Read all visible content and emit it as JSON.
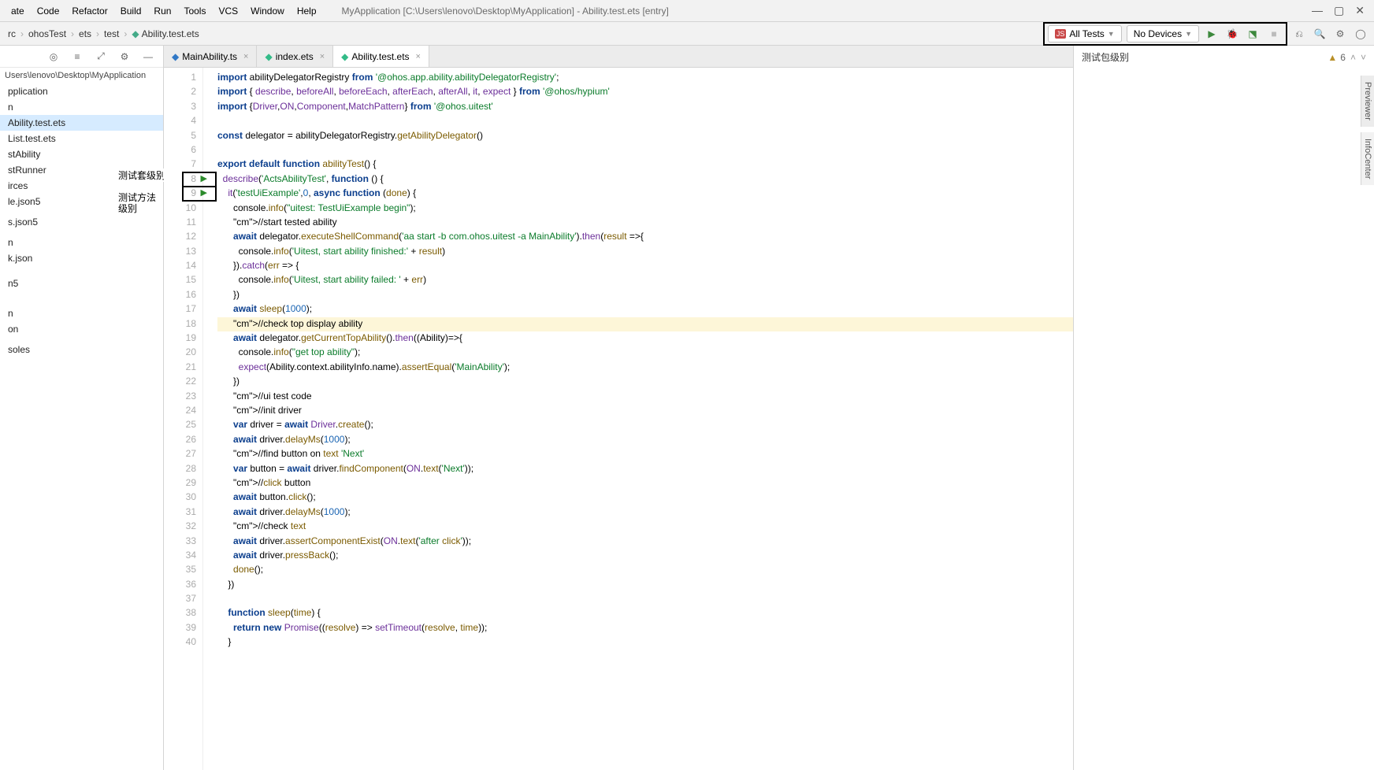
{
  "menubar": {
    "items": [
      "ate",
      "Code",
      "Refactor",
      "Build",
      "Run",
      "Tools",
      "VCS",
      "Window",
      "Help"
    ],
    "title": "MyApplication [C:\\Users\\lenovo\\Desktop\\MyApplication] - Ability.test.ets [entry]"
  },
  "breadcrumbs": [
    "rc",
    "ohosTest",
    "ets",
    "test",
    "Ability.test.ets"
  ],
  "run_config": {
    "label": "All Tests",
    "icon_color": "#c94747"
  },
  "device_dd": {
    "label": "No Devices"
  },
  "left": {
    "path": "Users\\lenovo\\Desktop\\MyApplication",
    "items": [
      "pplication",
      "n",
      "Ability.test.ets",
      "List.test.ets",
      "stAbility",
      "stRunner",
      "irces",
      "le.json5",
      "",
      "s.json5",
      "",
      "n",
      "k.json",
      "",
      "",
      "n5",
      "",
      "",
      "",
      "n",
      "on",
      "",
      "soles"
    ]
  },
  "left_labels": {
    "suite": "测试套级别",
    "method": "测试方法\n级别"
  },
  "tabs": [
    {
      "label": "MainAbility.ts",
      "active": false
    },
    {
      "label": "index.ets",
      "active": false
    },
    {
      "label": "Ability.test.ets",
      "active": true
    }
  ],
  "right": {
    "title": "测试包级别",
    "warn_count": "6"
  },
  "side_tabs": [
    "Previewer",
    "InfoCenter"
  ],
  "code": [
    {
      "n": 1,
      "t": "import abilityDelegatorRegistry from '@ohos.app.ability.abilityDelegatorRegistry';"
    },
    {
      "n": 2,
      "t": "import { describe, beforeAll, beforeEach, afterEach, afterAll, it, expect } from '@ohos/hypium'"
    },
    {
      "n": 3,
      "t": "import {Driver,ON,Component,MatchPattern} from '@ohos.uitest'"
    },
    {
      "n": 4,
      "t": ""
    },
    {
      "n": 5,
      "t": "const delegator = abilityDelegatorRegistry.getAbilityDelegator()"
    },
    {
      "n": 6,
      "t": ""
    },
    {
      "n": 7,
      "t": "export default function abilityTest() {"
    },
    {
      "n": 8,
      "t": "  describe('ActsAbilityTest', function () {",
      "run": true
    },
    {
      "n": 9,
      "t": "    it('testUiExample',0, async function (done) {",
      "run": true
    },
    {
      "n": 10,
      "t": "      console.info(\"uitest: TestUiExample begin\");"
    },
    {
      "n": 11,
      "t": "      //start tested ability"
    },
    {
      "n": 12,
      "t": "      await delegator.executeShellCommand('aa start -b com.ohos.uitest -a MainAbility').then(result =>{"
    },
    {
      "n": 13,
      "t": "        console.info('Uitest, start ability finished:' + result)"
    },
    {
      "n": 14,
      "t": "      }).catch(err => {"
    },
    {
      "n": 15,
      "t": "        console.info('Uitest, start ability failed: ' + err)"
    },
    {
      "n": 16,
      "t": "      })"
    },
    {
      "n": 17,
      "t": "      await sleep(1000);"
    },
    {
      "n": 18,
      "t": "      //check top display ability",
      "hl": true
    },
    {
      "n": 19,
      "t": "      await delegator.getCurrentTopAbility().then((Ability)=>{"
    },
    {
      "n": 20,
      "t": "        console.info(\"get top ability\");"
    },
    {
      "n": 21,
      "t": "        expect(Ability.context.abilityInfo.name).assertEqual('MainAbility');"
    },
    {
      "n": 22,
      "t": "      })"
    },
    {
      "n": 23,
      "t": "      //ui test code"
    },
    {
      "n": 24,
      "t": "      //init driver"
    },
    {
      "n": 25,
      "t": "      var driver = await Driver.create();"
    },
    {
      "n": 26,
      "t": "      await driver.delayMs(1000);"
    },
    {
      "n": 27,
      "t": "      //find button on text 'Next'"
    },
    {
      "n": 28,
      "t": "      var button = await driver.findComponent(ON.text('Next'));"
    },
    {
      "n": 29,
      "t": "      //click button"
    },
    {
      "n": 30,
      "t": "      await button.click();"
    },
    {
      "n": 31,
      "t": "      await driver.delayMs(1000);"
    },
    {
      "n": 32,
      "t": "      //check text"
    },
    {
      "n": 33,
      "t": "      await driver.assertComponentExist(ON.text('after click'));"
    },
    {
      "n": 34,
      "t": "      await driver.pressBack();"
    },
    {
      "n": 35,
      "t": "      done();"
    },
    {
      "n": 36,
      "t": "    })"
    },
    {
      "n": 37,
      "t": ""
    },
    {
      "n": 38,
      "t": "    function sleep(time) {"
    },
    {
      "n": 39,
      "t": "      return new Promise((resolve) => setTimeout(resolve, time));"
    },
    {
      "n": 40,
      "t": "    }"
    }
  ]
}
